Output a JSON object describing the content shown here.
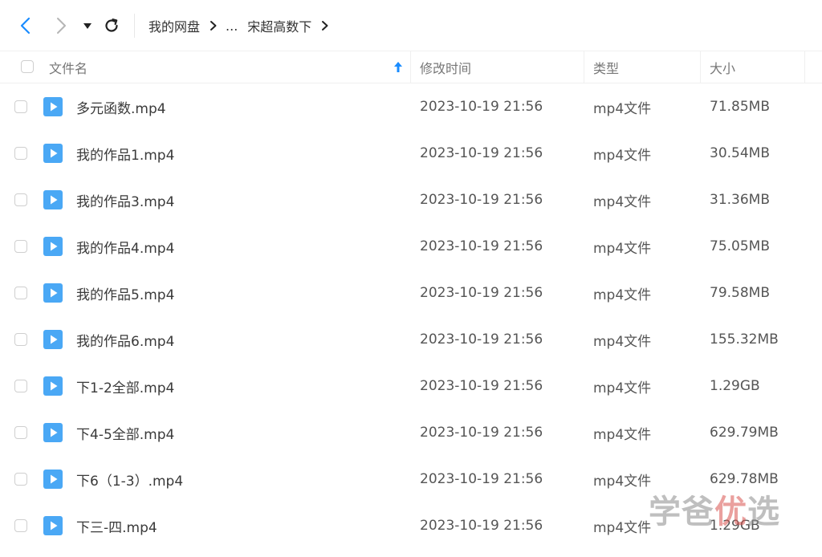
{
  "nav": {
    "breadcrumbs": [
      "我的网盘",
      "...",
      "宋超高数下"
    ]
  },
  "table": {
    "columns": {
      "name": "文件名",
      "modified": "修改时间",
      "type": "类型",
      "size": "大小"
    },
    "rows": [
      {
        "name": "多元函数.mp4",
        "modified": "2023-10-19 21:56",
        "type": "mp4文件",
        "size": "71.85MB"
      },
      {
        "name": "我的作品1.mp4",
        "modified": "2023-10-19 21:56",
        "type": "mp4文件",
        "size": "30.54MB"
      },
      {
        "name": "我的作品3.mp4",
        "modified": "2023-10-19 21:56",
        "type": "mp4文件",
        "size": "31.36MB"
      },
      {
        "name": "我的作品4.mp4",
        "modified": "2023-10-19 21:56",
        "type": "mp4文件",
        "size": "75.05MB"
      },
      {
        "name": "我的作品5.mp4",
        "modified": "2023-10-19 21:56",
        "type": "mp4文件",
        "size": "79.58MB"
      },
      {
        "name": "我的作品6.mp4",
        "modified": "2023-10-19 21:56",
        "type": "mp4文件",
        "size": "155.32MB"
      },
      {
        "name": "下1-2全部.mp4",
        "modified": "2023-10-19 21:56",
        "type": "mp4文件",
        "size": "1.29GB"
      },
      {
        "name": "下4-5全部.mp4",
        "modified": "2023-10-19 21:56",
        "type": "mp4文件",
        "size": "629.79MB"
      },
      {
        "name": "下6（1-3）.mp4",
        "modified": "2023-10-19 21:56",
        "type": "mp4文件",
        "size": "629.78MB"
      },
      {
        "name": "下三-四.mp4",
        "modified": "2023-10-19 21:56",
        "type": "mp4文件",
        "size": "1.29GB"
      }
    ]
  },
  "watermark": {
    "part1": "学爸",
    "part2": "优",
    "part3": "选"
  },
  "colors": {
    "accent": "#1a8cff",
    "file_icon": "#4aa8f5",
    "watermark_red": "#d9534f"
  },
  "icons": {
    "back": "chevron-left-icon",
    "forward": "chevron-right-icon",
    "dropdown": "caret-down-icon",
    "refresh": "refresh-icon",
    "sort": "sort-ascending-icon",
    "file": "video-file-icon"
  }
}
